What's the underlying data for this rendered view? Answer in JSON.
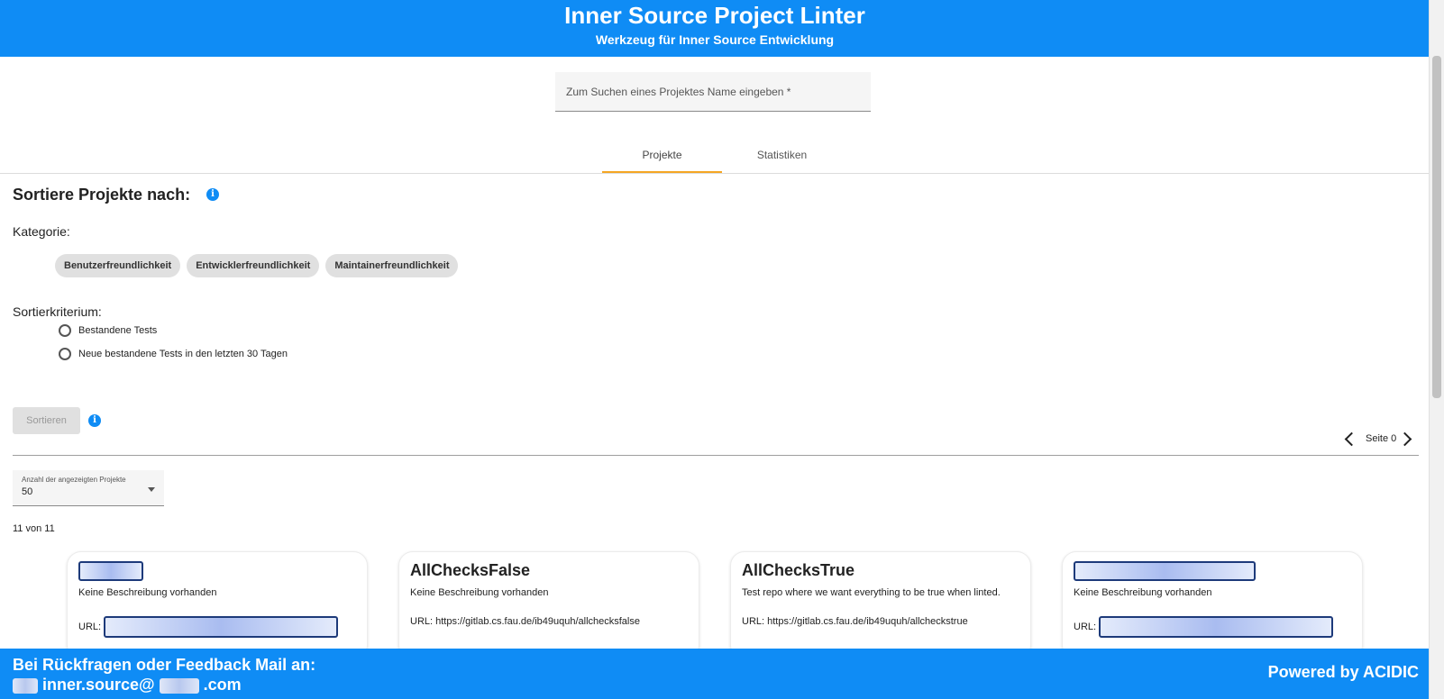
{
  "header": {
    "title": "Inner Source Project Linter",
    "subtitle": "Werkzeug für Inner Source Entwicklung"
  },
  "search": {
    "placeholder": "Zum Suchen eines Projektes Name eingeben *"
  },
  "tabs": [
    {
      "label": "Projekte",
      "active": true
    },
    {
      "label": "Statistiken",
      "active": false
    }
  ],
  "sort": {
    "title": "Sortiere Projekte nach:",
    "category_label": "Kategorie:",
    "categories": [
      "Benutzerfreundlichkeit",
      "Entwicklerfreundlichkeit",
      "Maintainerfreundlichkeit"
    ],
    "criterion_label": "Sortierkriterium:",
    "criteria": [
      "Bestandene Tests",
      "Neue bestandene Tests in den letzten 30 Tagen"
    ],
    "button_label": "Sortieren"
  },
  "pager": {
    "label": "Seite 0"
  },
  "page_size": {
    "label": "Anzahl der angezeigten Projekte",
    "value": "50"
  },
  "count": "11 von 11",
  "cards": [
    {
      "name": "",
      "description": "Keine Beschreibung vorhanden",
      "url_label": "URL:",
      "url": ""
    },
    {
      "name": "AllChecksFalse",
      "description": "Keine Beschreibung vorhanden",
      "url_label": "URL:",
      "url": "https://gitlab.cs.fau.de/ib49uquh/allchecksfalse"
    },
    {
      "name": "AllChecksTrue",
      "description": "Test repo where we want everything to be true when linted.",
      "url_label": "URL:",
      "url": "https://gitlab.cs.fau.de/ib49uquh/allcheckstrue"
    },
    {
      "name": "",
      "description": "Keine Beschreibung vorhanden",
      "url_label": "URL:",
      "url": ""
    }
  ],
  "footer": {
    "feedback_text": "Bei Rückfragen oder Feedback Mail an:",
    "email_middle": "inner.source@",
    "email_end": ".com",
    "powered": "Powered by ACIDIC"
  },
  "colors": {
    "primary": "#0f8cf5",
    "tab_indicator": "#f5a623"
  }
}
